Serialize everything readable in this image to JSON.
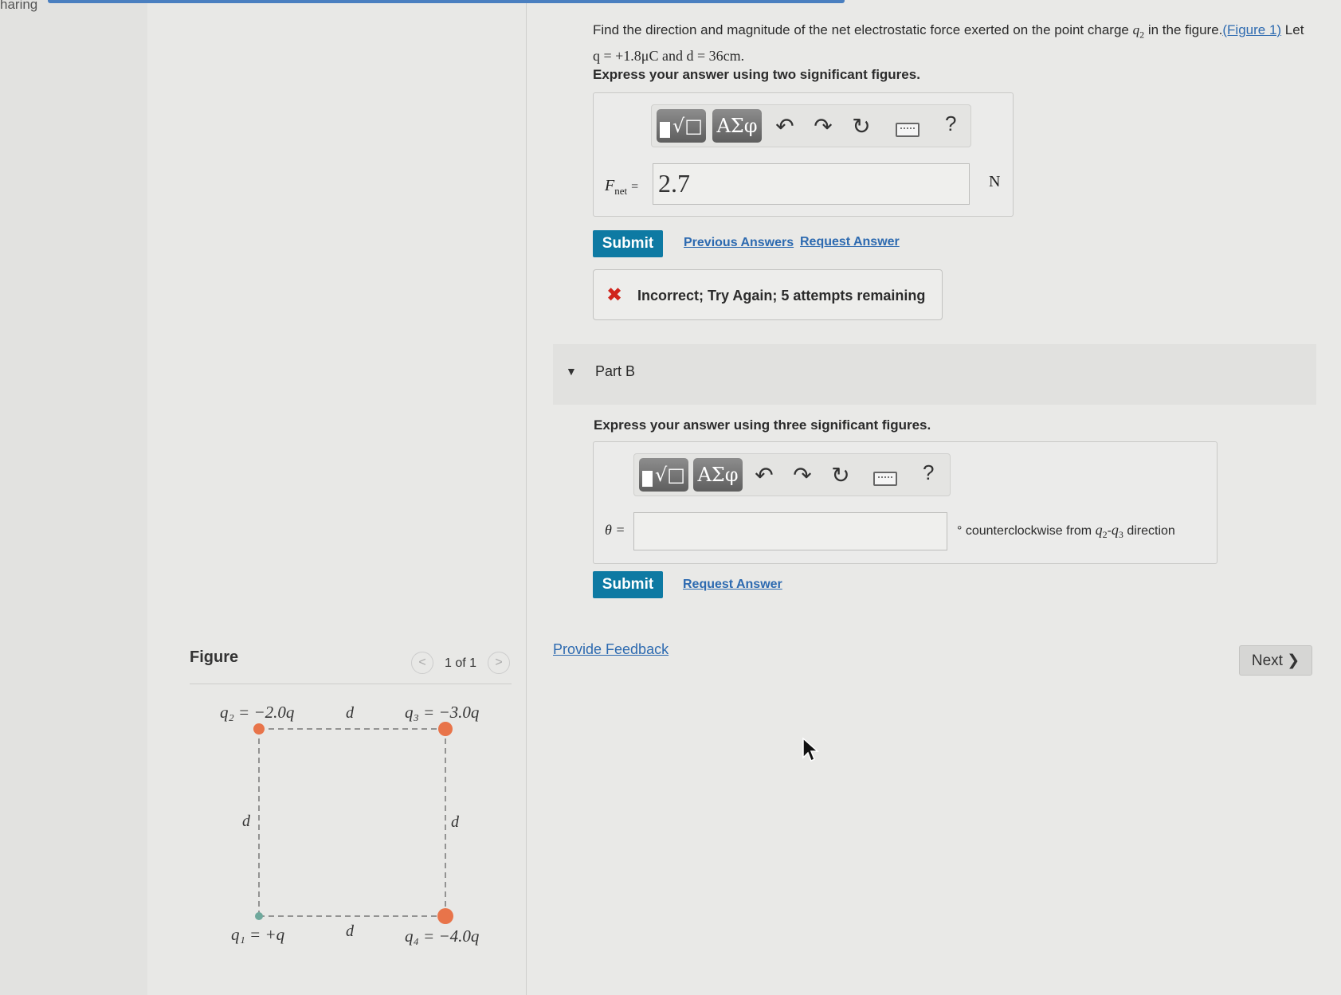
{
  "header": {
    "partial_label": "haring"
  },
  "problem": {
    "text_a": "Find the direction and magnitude of the net electrostatic force exerted on the point charge ",
    "q2": "q",
    "q2_sub": "2",
    "text_b": " in the figure.",
    "figure_link": "(Figure 1)",
    "text_c": " Let",
    "line2": "q = +1.8μC and d = 36cm."
  },
  "part_a": {
    "instruction": "Express your answer using two significant figures.",
    "var_label": "F",
    "var_sub": "net",
    "equals": "=",
    "value": "2.7",
    "unit": "N",
    "submit_label": "Submit",
    "previous_answers": "Previous Answers",
    "request_answer": "Request Answer",
    "feedback": "Incorrect; Try Again; 5 attempts remaining"
  },
  "toolbar": {
    "templates_glyph": "√□",
    "greek_label": "ΑΣφ",
    "undo_glyph": "↶",
    "redo_glyph": "↷",
    "reset_glyph": "↻",
    "help_glyph": "?"
  },
  "part_b": {
    "title": "Part B",
    "instruction": "Express your answer using three significant figures.",
    "var_label": "θ =",
    "value": "",
    "unit_a": "° counterclockwise from ",
    "unit_q": "q",
    "unit_sub2": "2",
    "unit_dash": "-",
    "unit_q3": "q",
    "unit_sub3": "3",
    "unit_b": " direction",
    "submit_label": "Submit",
    "request_answer": "Request Answer"
  },
  "provide_feedback": "Provide Feedback",
  "next_label": "Next ❯",
  "figure": {
    "title": "Figure",
    "pager": "1 of 1",
    "prev_glyph": "<",
    "next_glyph": ">",
    "q2_label": "q₂ = −2.0q",
    "q3_label": "q₃ = −3.0q",
    "q1_label": "q₁ = +q",
    "q4_label": "q₄ = −4.0q",
    "d_label": "d",
    "neg_color": "#e8744a",
    "pos_color": "#6fa89c"
  }
}
